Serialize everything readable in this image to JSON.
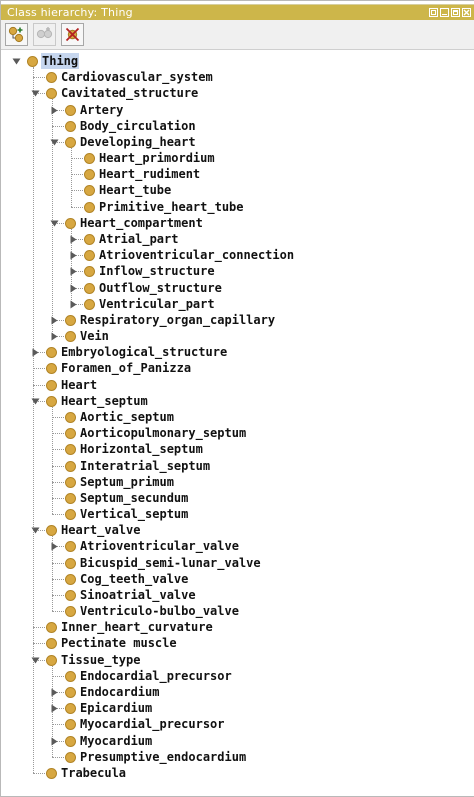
{
  "window": {
    "title": "Class hierarchy: Thing"
  },
  "toolbar": {
    "buttons": [
      {
        "icon": "add-subclass-icon",
        "enabled": true
      },
      {
        "icon": "add-sibling-icon",
        "enabled": false
      },
      {
        "icon": "delete-class-icon",
        "enabled": true
      }
    ]
  },
  "colors": {
    "titlebar": "#cdb64a",
    "bullet": "#d7a741",
    "selection": "#c6d6ee"
  },
  "tree": [
    {
      "label": "Thing",
      "depth": 0,
      "state": "expanded",
      "selected": true
    },
    {
      "label": "Cardiovascular_system",
      "depth": 1,
      "state": "leaf"
    },
    {
      "label": "Cavitated_structure",
      "depth": 1,
      "state": "expanded"
    },
    {
      "label": "Artery",
      "depth": 2,
      "state": "collapsed"
    },
    {
      "label": "Body_circulation",
      "depth": 2,
      "state": "leaf"
    },
    {
      "label": "Developing_heart",
      "depth": 2,
      "state": "expanded"
    },
    {
      "label": "Heart_primordium",
      "depth": 3,
      "state": "leaf"
    },
    {
      "label": "Heart_rudiment",
      "depth": 3,
      "state": "leaf"
    },
    {
      "label": "Heart_tube",
      "depth": 3,
      "state": "leaf"
    },
    {
      "label": "Primitive_heart_tube",
      "depth": 3,
      "state": "leaf"
    },
    {
      "label": "Heart_compartment",
      "depth": 2,
      "state": "expanded"
    },
    {
      "label": "Atrial_part",
      "depth": 3,
      "state": "collapsed"
    },
    {
      "label": "Atrioventricular_connection",
      "depth": 3,
      "state": "collapsed"
    },
    {
      "label": "Inflow_structure",
      "depth": 3,
      "state": "collapsed"
    },
    {
      "label": "Outflow_structure",
      "depth": 3,
      "state": "collapsed"
    },
    {
      "label": "Ventricular_part",
      "depth": 3,
      "state": "collapsed"
    },
    {
      "label": "Respiratory_organ_capillary",
      "depth": 2,
      "state": "collapsed"
    },
    {
      "label": "Vein",
      "depth": 2,
      "state": "collapsed"
    },
    {
      "label": "Embryological_structure",
      "depth": 1,
      "state": "collapsed"
    },
    {
      "label": "Foramen_of_Panizza",
      "depth": 1,
      "state": "leaf"
    },
    {
      "label": "Heart",
      "depth": 1,
      "state": "leaf"
    },
    {
      "label": "Heart_septum",
      "depth": 1,
      "state": "expanded"
    },
    {
      "label": "Aortic_septum",
      "depth": 2,
      "state": "leaf"
    },
    {
      "label": "Aorticopulmonary_septum",
      "depth": 2,
      "state": "leaf"
    },
    {
      "label": "Horizontal_septum",
      "depth": 2,
      "state": "leaf"
    },
    {
      "label": "Interatrial_septum",
      "depth": 2,
      "state": "leaf"
    },
    {
      "label": "Septum_primum",
      "depth": 2,
      "state": "leaf"
    },
    {
      "label": "Septum_secundum",
      "depth": 2,
      "state": "leaf"
    },
    {
      "label": "Vertical_septum",
      "depth": 2,
      "state": "leaf"
    },
    {
      "label": "Heart_valve",
      "depth": 1,
      "state": "expanded"
    },
    {
      "label": "Atrioventricular_valve",
      "depth": 2,
      "state": "collapsed"
    },
    {
      "label": "Bicuspid_semi-lunar_valve",
      "depth": 2,
      "state": "leaf"
    },
    {
      "label": "Cog_teeth_valve",
      "depth": 2,
      "state": "leaf"
    },
    {
      "label": "Sinoatrial_valve",
      "depth": 2,
      "state": "leaf"
    },
    {
      "label": "Ventriculo-bulbo_valve",
      "depth": 2,
      "state": "leaf"
    },
    {
      "label": "Inner_heart_curvature",
      "depth": 1,
      "state": "leaf"
    },
    {
      "label": "Pectinate muscle",
      "depth": 1,
      "state": "leaf"
    },
    {
      "label": "Tissue_type",
      "depth": 1,
      "state": "expanded"
    },
    {
      "label": "Endocardial_precursor",
      "depth": 2,
      "state": "leaf"
    },
    {
      "label": "Endocardium",
      "depth": 2,
      "state": "collapsed"
    },
    {
      "label": "Epicardium",
      "depth": 2,
      "state": "collapsed"
    },
    {
      "label": "Myocardial_precursor",
      "depth": 2,
      "state": "leaf"
    },
    {
      "label": "Myocardium",
      "depth": 2,
      "state": "collapsed"
    },
    {
      "label": "Presumptive_endocardium",
      "depth": 2,
      "state": "leaf"
    },
    {
      "label": "Trabecula",
      "depth": 1,
      "state": "leaf"
    }
  ]
}
